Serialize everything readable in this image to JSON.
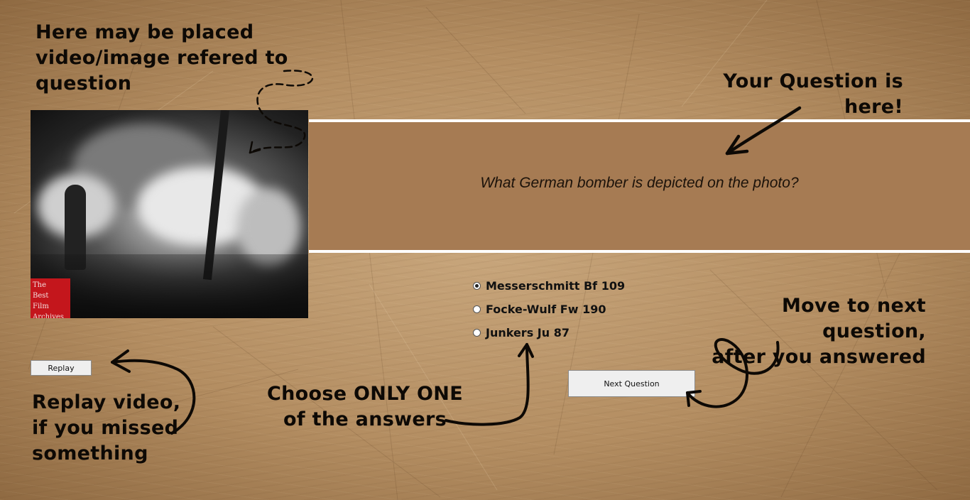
{
  "annotations": {
    "media": [
      "Here may be placed",
      "video/image refered to",
      "question"
    ],
    "question": [
      "Your Question is",
      "here!"
    ],
    "replay": [
      "Replay video,",
      "if you missed",
      "something"
    ],
    "choose": [
      "Choose ONLY ONE",
      "of the answers"
    ],
    "next": [
      "Move to next question,",
      "after you answered"
    ]
  },
  "media": {
    "watermark": [
      "The",
      "Best",
      "Film",
      "Archives"
    ]
  },
  "question": {
    "text": "What German bomber is depicted on the photo?"
  },
  "answers": [
    {
      "label": "Messerschmitt Bf 109",
      "selected": true
    },
    {
      "label": "Focke-Wulf Fw 190",
      "selected": false
    },
    {
      "label": "Junkers Ju 87",
      "selected": false
    }
  ],
  "buttons": {
    "replay": "Replay",
    "next": "Next Question"
  },
  "colors": {
    "question_band": "#a67b53",
    "text_dark": "#0d0905",
    "watermark_bg": "#c4161c"
  }
}
